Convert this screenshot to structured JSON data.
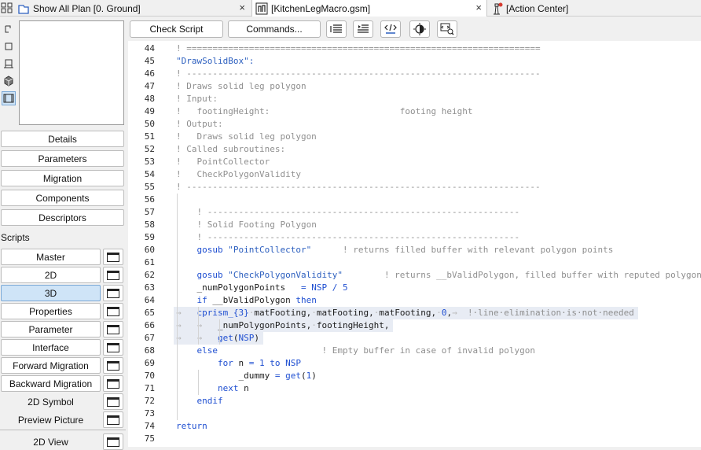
{
  "tabs": [
    {
      "label": "Show All Plan [0. Ground]",
      "icon": "floor-plan-icon"
    },
    {
      "label": "[KitchenLegMacro.gsm]",
      "icon": "gsm-object-icon"
    },
    {
      "label": "[Action Center]",
      "icon": "lighthouse-icon"
    }
  ],
  "close_glyph": "×",
  "left_panel": {
    "nav_buttons": [
      "Details",
      "Parameters",
      "Migration",
      "Components",
      "Descriptors"
    ],
    "scripts_label": "Scripts",
    "scripts": [
      {
        "label": "Master",
        "selected": false
      },
      {
        "label": "2D",
        "selected": false
      },
      {
        "label": "3D",
        "selected": true
      },
      {
        "label": "Properties",
        "selected": false
      },
      {
        "label": "Parameter",
        "selected": false
      },
      {
        "label": "Interface",
        "selected": false
      },
      {
        "label": "Forward Migration",
        "selected": false
      },
      {
        "label": "Backward Migration",
        "selected": false
      }
    ],
    "plain_scripts": [
      {
        "label": "2D Symbol"
      },
      {
        "label": "Preview Picture"
      }
    ],
    "view_button": "2D View"
  },
  "toolbar": {
    "check_script": "Check Script",
    "commands": "Commands..."
  },
  "colors": {
    "accent_selected": "#cfe4f7",
    "comment": "#8f8f8f",
    "keyword": "#1f4fd1",
    "string": "#2c5fbf"
  },
  "code_lines": [
    {
      "n": "44",
      "segs": [
        [
          "com",
          "! ===================================================================="
        ]
      ]
    },
    {
      "n": "45",
      "segs": [
        [
          "str",
          "\"DrawSolidBox\":"
        ]
      ]
    },
    {
      "n": "46",
      "segs": [
        [
          "com",
          "! --------------------------------------------------------------------"
        ]
      ]
    },
    {
      "n": "47",
      "segs": [
        [
          "com",
          "! Draws solid leg polygon"
        ]
      ]
    },
    {
      "n": "48",
      "segs": [
        [
          "com",
          "! Input:"
        ]
      ]
    },
    {
      "n": "49",
      "segs": [
        [
          "com",
          "!   footingHeight:                         footing height"
        ]
      ]
    },
    {
      "n": "50",
      "segs": [
        [
          "com",
          "! Output:"
        ]
      ]
    },
    {
      "n": "51",
      "segs": [
        [
          "com",
          "!   Draws solid leg polygon"
        ]
      ]
    },
    {
      "n": "52",
      "segs": [
        [
          "com",
          "! Called subroutines:"
        ]
      ]
    },
    {
      "n": "53",
      "segs": [
        [
          "com",
          "!   PointCollector"
        ]
      ]
    },
    {
      "n": "54",
      "segs": [
        [
          "com",
          "!   CheckPolygonValidity"
        ]
      ]
    },
    {
      "n": "55",
      "segs": [
        [
          "com",
          "! --------------------------------------------------------------------"
        ]
      ]
    },
    {
      "n": "56",
      "segs": []
    },
    {
      "n": "57",
      "segs": [
        [
          "txt",
          "    "
        ],
        [
          "com",
          "! ------------------------------------------------------------"
        ]
      ]
    },
    {
      "n": "58",
      "segs": [
        [
          "txt",
          "    "
        ],
        [
          "com",
          "! Solid Footing Polygon"
        ]
      ]
    },
    {
      "n": "59",
      "segs": [
        [
          "txt",
          "    "
        ],
        [
          "com",
          "! ------------------------------------------------------------"
        ]
      ]
    },
    {
      "n": "60",
      "segs": [
        [
          "txt",
          "    "
        ],
        [
          "kw",
          "gosub"
        ],
        [
          "txt",
          " "
        ],
        [
          "str",
          "\"PointCollector\""
        ],
        [
          "txt",
          "      "
        ],
        [
          "com",
          "! returns filled buffer with relevant polygon points"
        ]
      ]
    },
    {
      "n": "61",
      "segs": []
    },
    {
      "n": "62",
      "segs": [
        [
          "txt",
          "    "
        ],
        [
          "kw",
          "gosub"
        ],
        [
          "txt",
          " "
        ],
        [
          "str",
          "\"CheckPolygonValidity\""
        ],
        [
          "txt",
          "        "
        ],
        [
          "com",
          "! returns __bValidPolygon, filled buffer with reputed polygon"
        ]
      ]
    },
    {
      "n": "63",
      "segs": [
        [
          "txt",
          "    _numPolygonPoints   "
        ],
        [
          "op",
          "="
        ],
        [
          "txt",
          " "
        ],
        [
          "kw",
          "NSP"
        ],
        [
          "txt",
          " "
        ],
        [
          "op",
          "/"
        ],
        [
          "txt",
          " "
        ],
        [
          "num",
          "5"
        ]
      ]
    },
    {
      "n": "64",
      "segs": [
        [
          "txt",
          "    "
        ],
        [
          "kw",
          "if"
        ],
        [
          "txt",
          " __bValidPolygon "
        ],
        [
          "kw",
          "then"
        ]
      ]
    },
    {
      "n": "65",
      "hl": true,
      "segs": [
        [
          "ws",
          "→   "
        ],
        [
          "kw",
          "cprism_{3}"
        ],
        [
          "ws",
          "·"
        ],
        [
          "txt",
          "matFooting,"
        ],
        [
          "ws",
          "·"
        ],
        [
          "txt",
          "matFooting,"
        ],
        [
          "ws",
          "·"
        ],
        [
          "txt",
          "matFooting,"
        ],
        [
          "ws",
          "·"
        ],
        [
          "num",
          "0"
        ],
        [
          "txt",
          ","
        ],
        [
          "ws",
          "→  "
        ],
        [
          "com",
          "!·line·elimination·is·not·needed"
        ]
      ]
    },
    {
      "n": "66",
      "hl": true,
      "segs": [
        [
          "ws",
          "→   →   "
        ],
        [
          "txt",
          "_numPolygonPoints,"
        ],
        [
          "ws",
          "·"
        ],
        [
          "txt",
          "footingHeight,"
        ]
      ]
    },
    {
      "n": "67",
      "hl": true,
      "segs": [
        [
          "ws",
          "→   →   "
        ],
        [
          "kw",
          "get"
        ],
        [
          "txt",
          "("
        ],
        [
          "kw",
          "NSP"
        ],
        [
          "txt",
          ")"
        ]
      ]
    },
    {
      "n": "68",
      "segs": [
        [
          "txt",
          "    "
        ],
        [
          "kw",
          "else"
        ],
        [
          "txt",
          "                    "
        ],
        [
          "com",
          "! Empty buffer in case of invalid polygon"
        ]
      ]
    },
    {
      "n": "69",
      "segs": [
        [
          "txt",
          "        "
        ],
        [
          "kw",
          "for"
        ],
        [
          "txt",
          " n "
        ],
        [
          "op",
          "="
        ],
        [
          "txt",
          " "
        ],
        [
          "num",
          "1"
        ],
        [
          "txt",
          " "
        ],
        [
          "kw",
          "to"
        ],
        [
          "txt",
          " "
        ],
        [
          "kw",
          "NSP"
        ]
      ]
    },
    {
      "n": "70",
      "segs": [
        [
          "txt",
          "            _dummy "
        ],
        [
          "op",
          "="
        ],
        [
          "txt",
          " "
        ],
        [
          "kw",
          "get"
        ],
        [
          "txt",
          "("
        ],
        [
          "num",
          "1"
        ],
        [
          "txt",
          ")"
        ]
      ]
    },
    {
      "n": "71",
      "segs": [
        [
          "txt",
          "        "
        ],
        [
          "kw",
          "next"
        ],
        [
          "txt",
          " n"
        ]
      ]
    },
    {
      "n": "72",
      "segs": [
        [
          "txt",
          "    "
        ],
        [
          "kw",
          "endif"
        ]
      ]
    },
    {
      "n": "73",
      "segs": []
    },
    {
      "n": "74",
      "segs": [
        [
          "kw",
          "return"
        ]
      ]
    },
    {
      "n": "75",
      "segs": []
    }
  ]
}
